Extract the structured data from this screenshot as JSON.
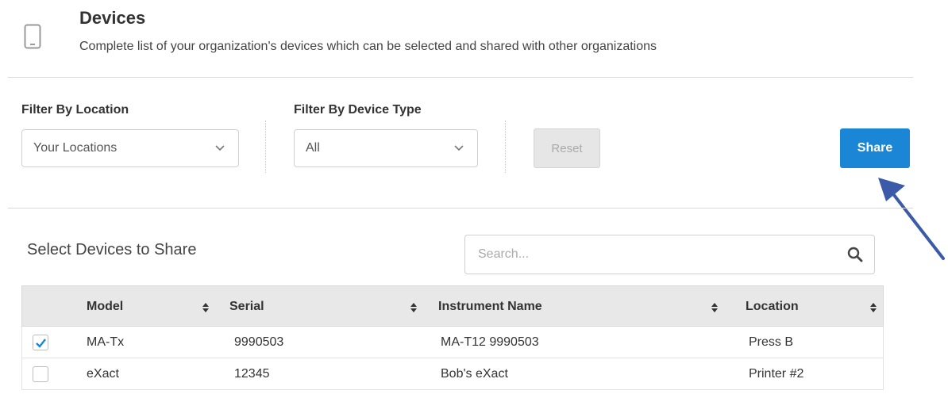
{
  "header": {
    "icon": "mobile-device-icon",
    "title": "Devices",
    "subtitle": "Complete list of your organization's devices which can be selected and shared with other organizations"
  },
  "filters": {
    "location": {
      "label": "Filter By Location",
      "value": "Your Locations"
    },
    "device_type": {
      "label": "Filter By Device Type",
      "value": "All"
    },
    "reset_label": "Reset",
    "share_label": "Share"
  },
  "devices": {
    "section_title": "Select Devices to Share",
    "search_placeholder": "Search...",
    "columns": [
      "Model",
      "Serial",
      "Instrument Name",
      "Location"
    ],
    "rows": [
      {
        "checked": true,
        "model": "MA-Tx",
        "serial": "9990503",
        "instrument_name": "MA-T12 9990503",
        "location": "Press B"
      },
      {
        "checked": false,
        "model": "eXact",
        "serial": "12345",
        "instrument_name": "Bob's eXact",
        "location": "Printer #2"
      }
    ]
  },
  "colors": {
    "accent": "#1b86d6",
    "arrow": "#3b5aa8",
    "check": "#1b86d6"
  }
}
